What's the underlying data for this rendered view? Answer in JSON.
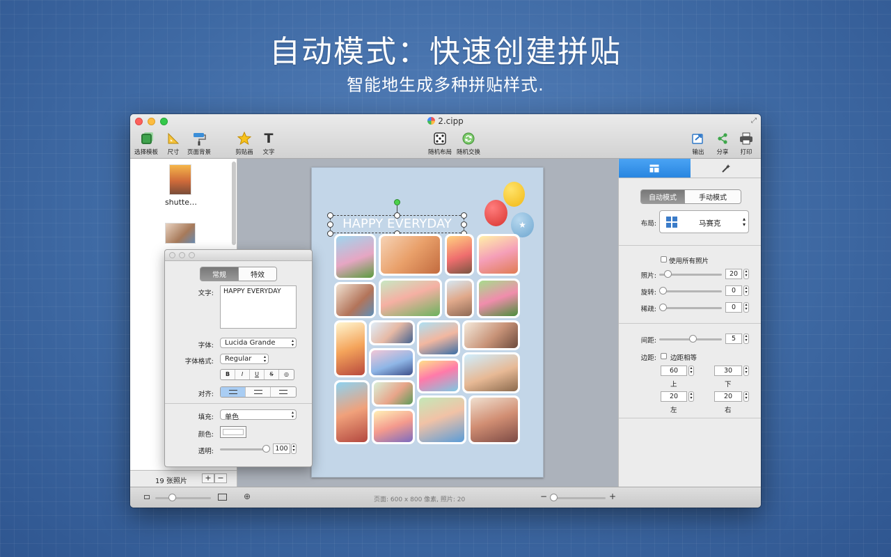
{
  "hero": {
    "title": "自动模式：快速创建拼贴",
    "subtitle": "智能地生成多种拼贴样式."
  },
  "window": {
    "title": "2.cipp"
  },
  "toolbar": {
    "items": [
      {
        "label": "选择模板",
        "icon": "template-icon"
      },
      {
        "label": "尺寸",
        "icon": "ruler-icon"
      },
      {
        "label": "页面背景",
        "icon": "paint-roller-icon"
      },
      {
        "label": "剪贴画",
        "icon": "star-icon"
      },
      {
        "label": "文字",
        "icon": "text-icon"
      },
      {
        "label": "随机布局",
        "icon": "dice-icon"
      },
      {
        "label": "随机交换",
        "icon": "shuffle-icon"
      },
      {
        "label": "输出",
        "icon": "export-icon"
      },
      {
        "label": "分享",
        "icon": "share-icon"
      },
      {
        "label": "打印",
        "icon": "printer-icon"
      }
    ]
  },
  "sidebar": {
    "thumb1_label": "shutte…",
    "photo_count": "19 张照片",
    "add_label": "+",
    "remove_label": "−"
  },
  "canvas": {
    "text": "HAPPY EVERYDAY",
    "background_color": "#c3d6e8"
  },
  "inspector": {
    "tabs": [
      "常规",
      "特效"
    ],
    "text_label": "文字:",
    "text_value": "HAPPY EVERYDAY",
    "font_label": "字体:",
    "font_value": "Lucida Grande",
    "style_label": "字体格式:",
    "style_value": "Regular",
    "format_buttons": [
      "B",
      "I",
      "U",
      "S",
      "◎"
    ],
    "align_label": "对齐:",
    "fill_label": "填充:",
    "fill_value": "单色",
    "color_label": "颜色:",
    "color_value": "#ffffff",
    "opacity_label": "透明:",
    "opacity_value": "100",
    "opacity_level": 1.0
  },
  "right_panel": {
    "mode_tabs": [
      "自动模式",
      "手动模式"
    ],
    "layout_label": "布局:",
    "layout_value": "马赛克",
    "use_all_label": "使用所有照片",
    "photos_label": "照片:",
    "photos_value": "20",
    "rotate_label": "旋转:",
    "rotate_value": "0",
    "sparse_label": "稀疏:",
    "sparse_value": "0",
    "spacing_label": "间距:",
    "spacing_value": "5",
    "margin_label": "边距:",
    "equal_margin_label": "边距相等",
    "top_value": "60",
    "top_label": "上",
    "bottom_value": "30",
    "bottom_label": "下",
    "left_value": "20",
    "left_label": "左",
    "right_value": "20",
    "right_label": "右"
  },
  "bottombar": {
    "status": "页面: 600 x 800 像素, 照片: 20",
    "zoom_minus": "−",
    "zoom_plus": "+"
  },
  "colors": {
    "accent": "#2986e0",
    "background": "#3f6aa4"
  }
}
